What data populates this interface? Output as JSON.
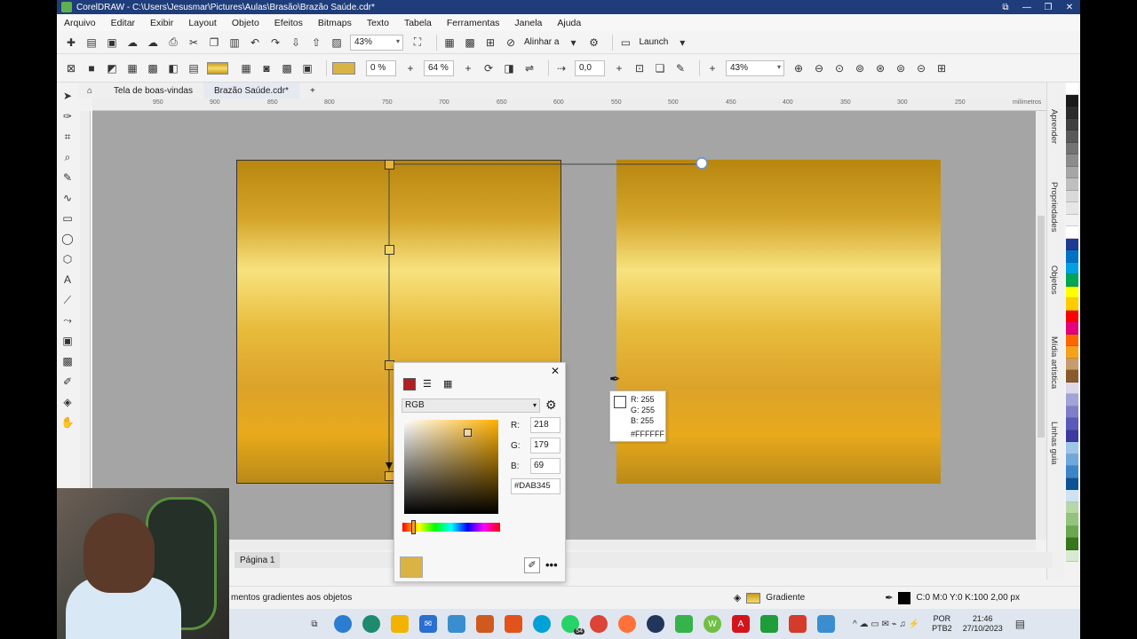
{
  "window": {
    "title": "CorelDRAW - C:\\Users\\Jesusmar\\Pictures\\Aulas\\Brasão\\Brazão Saúde.cdr*"
  },
  "menu": [
    "Arquivo",
    "Editar",
    "Exibir",
    "Layout",
    "Objeto",
    "Efeitos",
    "Bitmaps",
    "Texto",
    "Tabela",
    "Ferramentas",
    "Janela",
    "Ajuda"
  ],
  "toolbar1": {
    "zoom": "43%",
    "align_label": "Alinhar a",
    "launch_label": "Launch"
  },
  "toolbar2": {
    "transparency": "0 %",
    "midpoint": "64 %",
    "angle": "0,0",
    "zoom": "43%"
  },
  "tabs": [
    "Tela de boas-vindas",
    "Brazão Saúde.cdr*"
  ],
  "ruler": {
    "marks": [
      "950",
      "900",
      "850",
      "800",
      "750",
      "700",
      "650",
      "600",
      "550",
      "500",
      "450",
      "400",
      "350",
      "300",
      "250"
    ],
    "unit": "milímetros"
  },
  "docker_tabs": [
    "Aprender",
    "Propriedades",
    "Objetos",
    "Mídia artística",
    "Linhas guia"
  ],
  "page_tab": "Página 1",
  "color_popup": {
    "model": "RGB",
    "r_label": "R:",
    "r": "218",
    "g_label": "G:",
    "g": "179",
    "b_label": "B:",
    "b": "69",
    "hex": "#DAB345",
    "current_color": "#DAB345"
  },
  "tooltip": {
    "r": "R: 255",
    "g": "G: 255",
    "b": "B: 255",
    "hex": "#FFFFFF"
  },
  "status": {
    "hint": "mentos gradientes aos objetos",
    "fill_label": "Gradiente",
    "outline": "C:0 M:0 Y:0 K:100 2,00 px"
  },
  "taskbar": {
    "lang": "POR",
    "layout": "PTB2",
    "time": "21:46",
    "date": "27/10/2023",
    "badge": "54"
  },
  "palette_colors": [
    "#ffffff",
    "#1a1a1a",
    "#2b2b2b",
    "#404040",
    "#595959",
    "#737373",
    "#8c8c8c",
    "#a6a6a6",
    "#bfbfbf",
    "#d9d9d9",
    "#e6e6e6",
    "#f2f2f2",
    "#ffffff",
    "#1f3a93",
    "#0072c6",
    "#00a1e0",
    "#00a651",
    "#ffff00",
    "#ffcc00",
    "#ff0000",
    "#e4007c",
    "#ff6600",
    "#f7a11b",
    "#c69c6d",
    "#8b5a2b",
    "#d9d9ea",
    "#a3a3d9",
    "#7f7fc9",
    "#5a5ab8",
    "#3a3aa0",
    "#9fc5e8",
    "#6fa8dc",
    "#3d85c6",
    "#0b5394",
    "#cfe2f3",
    "#b6d7a8",
    "#93c47d",
    "#6aa84f",
    "#38761d",
    "#d9ead3"
  ]
}
